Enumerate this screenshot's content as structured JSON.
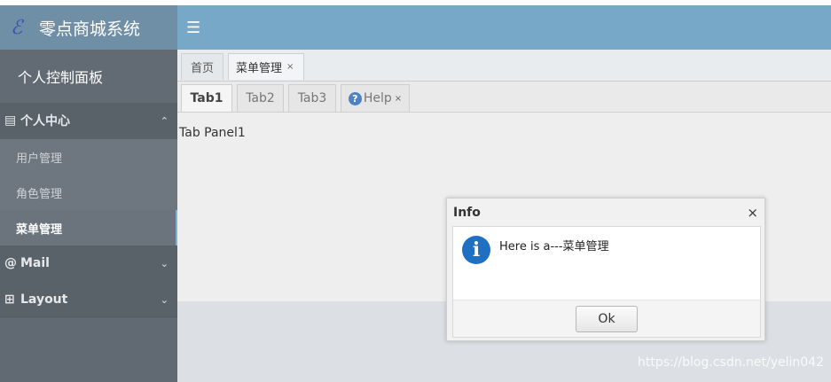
{
  "app": {
    "logo_glyph": "ℰ",
    "title": "零点商城系统"
  },
  "topbar": {
    "menu_icon": "☰"
  },
  "sidebar": {
    "user_panel": "个人控制面板",
    "groups": [
      {
        "icon": "▤",
        "label": "个人中心",
        "chevron": "⌃",
        "items": [
          "用户管理",
          "角色管理",
          "菜单管理"
        ],
        "active_item": "菜单管理"
      },
      {
        "icon": "@",
        "label": "Mail",
        "chevron": "⌄"
      },
      {
        "icon": "⊞",
        "label": "Layout",
        "chevron": "⌄"
      }
    ]
  },
  "outer_tabs": [
    {
      "label": "首页",
      "closable": false
    },
    {
      "label": "菜单管理",
      "closable": true,
      "close": "×"
    }
  ],
  "inner_tabs": [
    {
      "label": "Tab1"
    },
    {
      "label": "Tab2"
    },
    {
      "label": "Tab3"
    },
    {
      "label": "Help",
      "help_icon": "?",
      "close": "×"
    }
  ],
  "panel_text": "Tab Panel1",
  "dialog": {
    "title": "Info",
    "close": "×",
    "icon": "i",
    "message": "Here is a---菜单管理",
    "ok_label": "Ok"
  },
  "watermark": "https://blog.csdn.net/yelin042",
  "colors": {
    "topbar": "#78a8c7",
    "logo_bg": "#6f8fa6",
    "sidebar": "#616a72",
    "info_icon": "#1f6fc2"
  }
}
